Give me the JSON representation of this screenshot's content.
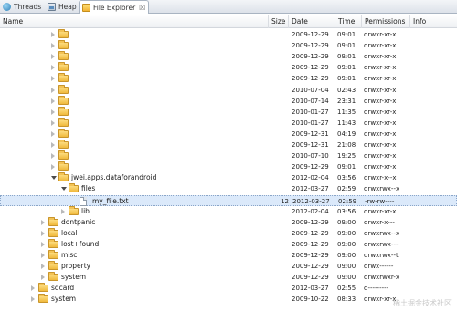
{
  "tabs": [
    {
      "label": "Threads",
      "icon": "threads-icon"
    },
    {
      "label": "Heap",
      "icon": "heap-icon"
    },
    {
      "label": "File Explorer",
      "icon": "file-explorer-icon",
      "active": true,
      "close": "☒"
    }
  ],
  "columns": {
    "name": "Name",
    "size": "Size",
    "date": "Date",
    "time": "Time",
    "permissions": "Permissions",
    "info": "Info"
  },
  "rows": [
    {
      "depth": 2,
      "toggle": "collapsed",
      "kind": "folder",
      "name": "",
      "size": "",
      "date": "2009-12-29",
      "time": "09:01",
      "perm": "drwxr-xr-x"
    },
    {
      "depth": 2,
      "toggle": "collapsed",
      "kind": "folder",
      "name": "",
      "size": "",
      "date": "2009-12-29",
      "time": "09:01",
      "perm": "drwxr-xr-x"
    },
    {
      "depth": 2,
      "toggle": "collapsed",
      "kind": "folder",
      "name": "",
      "size": "",
      "date": "2009-12-29",
      "time": "09:01",
      "perm": "drwxr-xr-x"
    },
    {
      "depth": 2,
      "toggle": "collapsed",
      "kind": "folder",
      "name": "",
      "size": "",
      "date": "2009-12-29",
      "time": "09:01",
      "perm": "drwxr-xr-x"
    },
    {
      "depth": 2,
      "toggle": "collapsed",
      "kind": "folder",
      "name": "",
      "size": "",
      "date": "2009-12-29",
      "time": "09:01",
      "perm": "drwxr-xr-x"
    },
    {
      "depth": 2,
      "toggle": "collapsed",
      "kind": "folder",
      "name": "",
      "size": "",
      "date": "2010-07-04",
      "time": "02:43",
      "perm": "drwxr-xr-x"
    },
    {
      "depth": 2,
      "toggle": "collapsed",
      "kind": "folder",
      "name": "",
      "size": "",
      "date": "2010-07-14",
      "time": "23:31",
      "perm": "drwxr-xr-x"
    },
    {
      "depth": 2,
      "toggle": "collapsed",
      "kind": "folder",
      "name": "",
      "size": "",
      "date": "2010-01-27",
      "time": "11:35",
      "perm": "drwxr-xr-x"
    },
    {
      "depth": 2,
      "toggle": "collapsed",
      "kind": "folder",
      "name": "",
      "size": "",
      "date": "2010-01-27",
      "time": "11:43",
      "perm": "drwxr-xr-x"
    },
    {
      "depth": 2,
      "toggle": "collapsed",
      "kind": "folder",
      "name": "",
      "size": "",
      "date": "2009-12-31",
      "time": "04:19",
      "perm": "drwxr-xr-x"
    },
    {
      "depth": 2,
      "toggle": "collapsed",
      "kind": "folder",
      "name": "",
      "size": "",
      "date": "2009-12-31",
      "time": "21:08",
      "perm": "drwxr-xr-x"
    },
    {
      "depth": 2,
      "toggle": "collapsed",
      "kind": "folder",
      "name": "",
      "size": "",
      "date": "2010-07-10",
      "time": "19:25",
      "perm": "drwxr-xr-x"
    },
    {
      "depth": 2,
      "toggle": "collapsed",
      "kind": "folder",
      "name": "",
      "size": "",
      "date": "2009-12-29",
      "time": "09:01",
      "perm": "drwxr-xr-x"
    },
    {
      "depth": 2,
      "toggle": "expanded",
      "kind": "folder",
      "name": "jwei.apps.dataforandroid",
      "size": "",
      "date": "2012-02-04",
      "time": "03:56",
      "perm": "drwxr-x--x"
    },
    {
      "depth": 3,
      "toggle": "expanded",
      "kind": "folder",
      "name": "files",
      "size": "",
      "date": "2012-03-27",
      "time": "02:59",
      "perm": "drwxrwx--x"
    },
    {
      "depth": 4,
      "toggle": "none",
      "kind": "file",
      "name": "my_file.txt",
      "size": "12",
      "date": "2012-03-27",
      "time": "02:59",
      "perm": "-rw-rw----",
      "selected": true
    },
    {
      "depth": 3,
      "toggle": "collapsed",
      "kind": "folder",
      "name": "lib",
      "size": "",
      "date": "2012-02-04",
      "time": "03:56",
      "perm": "drwxr-xr-x"
    },
    {
      "depth": 1,
      "toggle": "collapsed",
      "kind": "folder",
      "name": "dontpanic",
      "size": "",
      "date": "2009-12-29",
      "time": "09:00",
      "perm": "drwxr-x---"
    },
    {
      "depth": 1,
      "toggle": "collapsed",
      "kind": "folder",
      "name": "local",
      "size": "",
      "date": "2009-12-29",
      "time": "09:00",
      "perm": "drwxrwx--x"
    },
    {
      "depth": 1,
      "toggle": "collapsed",
      "kind": "folder",
      "name": "lost+found",
      "size": "",
      "date": "2009-12-29",
      "time": "09:00",
      "perm": "drwxrwx---"
    },
    {
      "depth": 1,
      "toggle": "collapsed",
      "kind": "folder",
      "name": "misc",
      "size": "",
      "date": "2009-12-29",
      "time": "09:00",
      "perm": "drwxrwx--t"
    },
    {
      "depth": 1,
      "toggle": "collapsed",
      "kind": "folder",
      "name": "property",
      "size": "",
      "date": "2009-12-29",
      "time": "09:00",
      "perm": "drwx------"
    },
    {
      "depth": 1,
      "toggle": "collapsed",
      "kind": "folder",
      "name": "system",
      "size": "",
      "date": "2009-12-29",
      "time": "09:00",
      "perm": "drwxrwxr-x"
    },
    {
      "depth": 0,
      "toggle": "collapsed",
      "kind": "folder",
      "name": "sdcard",
      "size": "",
      "date": "2012-03-27",
      "time": "02:55",
      "perm": "d---------"
    },
    {
      "depth": 0,
      "toggle": "collapsed",
      "kind": "folder",
      "name": "system",
      "size": "",
      "date": "2009-10-22",
      "time": "08:33",
      "perm": "drwxr-xr-x"
    }
  ],
  "watermark": "稀土掘金技术社区"
}
